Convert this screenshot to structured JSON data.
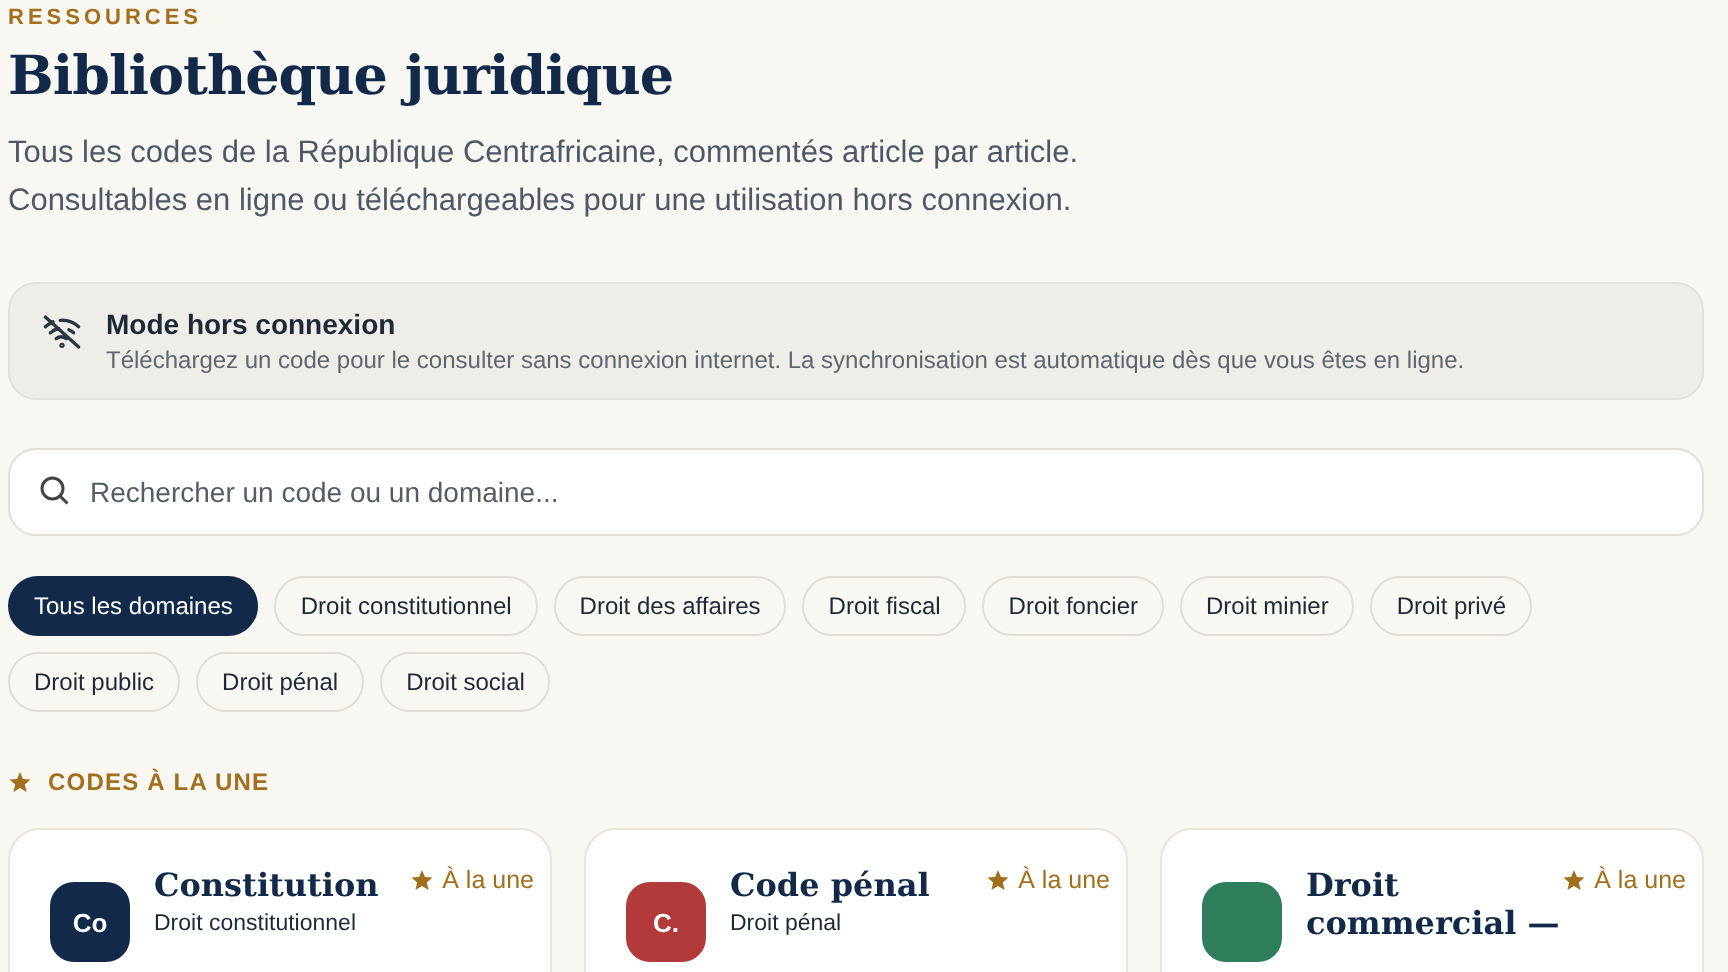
{
  "eyebrow": "RESSOURCES",
  "title": "Bibliothèque juridique",
  "intro": [
    "Tous les codes de la République Centrafricaine, commentés article par article.",
    "Consultables en ligne ou téléchargeables pour une utilisation hors connexion."
  ],
  "offline_notice": {
    "title": "Mode hors connexion",
    "text": "Téléchargez un code pour le consulter sans connexion internet. La synchronisation est automatique dès que vous êtes en ligne."
  },
  "search": {
    "placeholder": "Rechercher un code ou un domaine..."
  },
  "filters": [
    {
      "label": "Tous les domaines",
      "selected": true
    },
    {
      "label": "Droit constitutionnel",
      "selected": false
    },
    {
      "label": "Droit des affaires",
      "selected": false
    },
    {
      "label": "Droit fiscal",
      "selected": false
    },
    {
      "label": "Droit foncier",
      "selected": false
    },
    {
      "label": "Droit minier",
      "selected": false
    },
    {
      "label": "Droit privé",
      "selected": false
    },
    {
      "label": "Droit public",
      "selected": false
    },
    {
      "label": "Droit pénal",
      "selected": false
    },
    {
      "label": "Droit social",
      "selected": false
    }
  ],
  "featured": {
    "heading": "CODES À LA UNE",
    "cards": [
      {
        "badge": "Co",
        "color": "#12294a",
        "title": "Constitution",
        "domain": "Droit constitutionnel",
        "tag": "À la une"
      },
      {
        "badge": "C.",
        "color": "#b23a3a",
        "title": "Code pénal",
        "domain": "Droit pénal",
        "tag": "À la une"
      },
      {
        "color": "#2e7d5b",
        "title": "Droit commercial —",
        "tag": "À la une"
      }
    ]
  }
}
